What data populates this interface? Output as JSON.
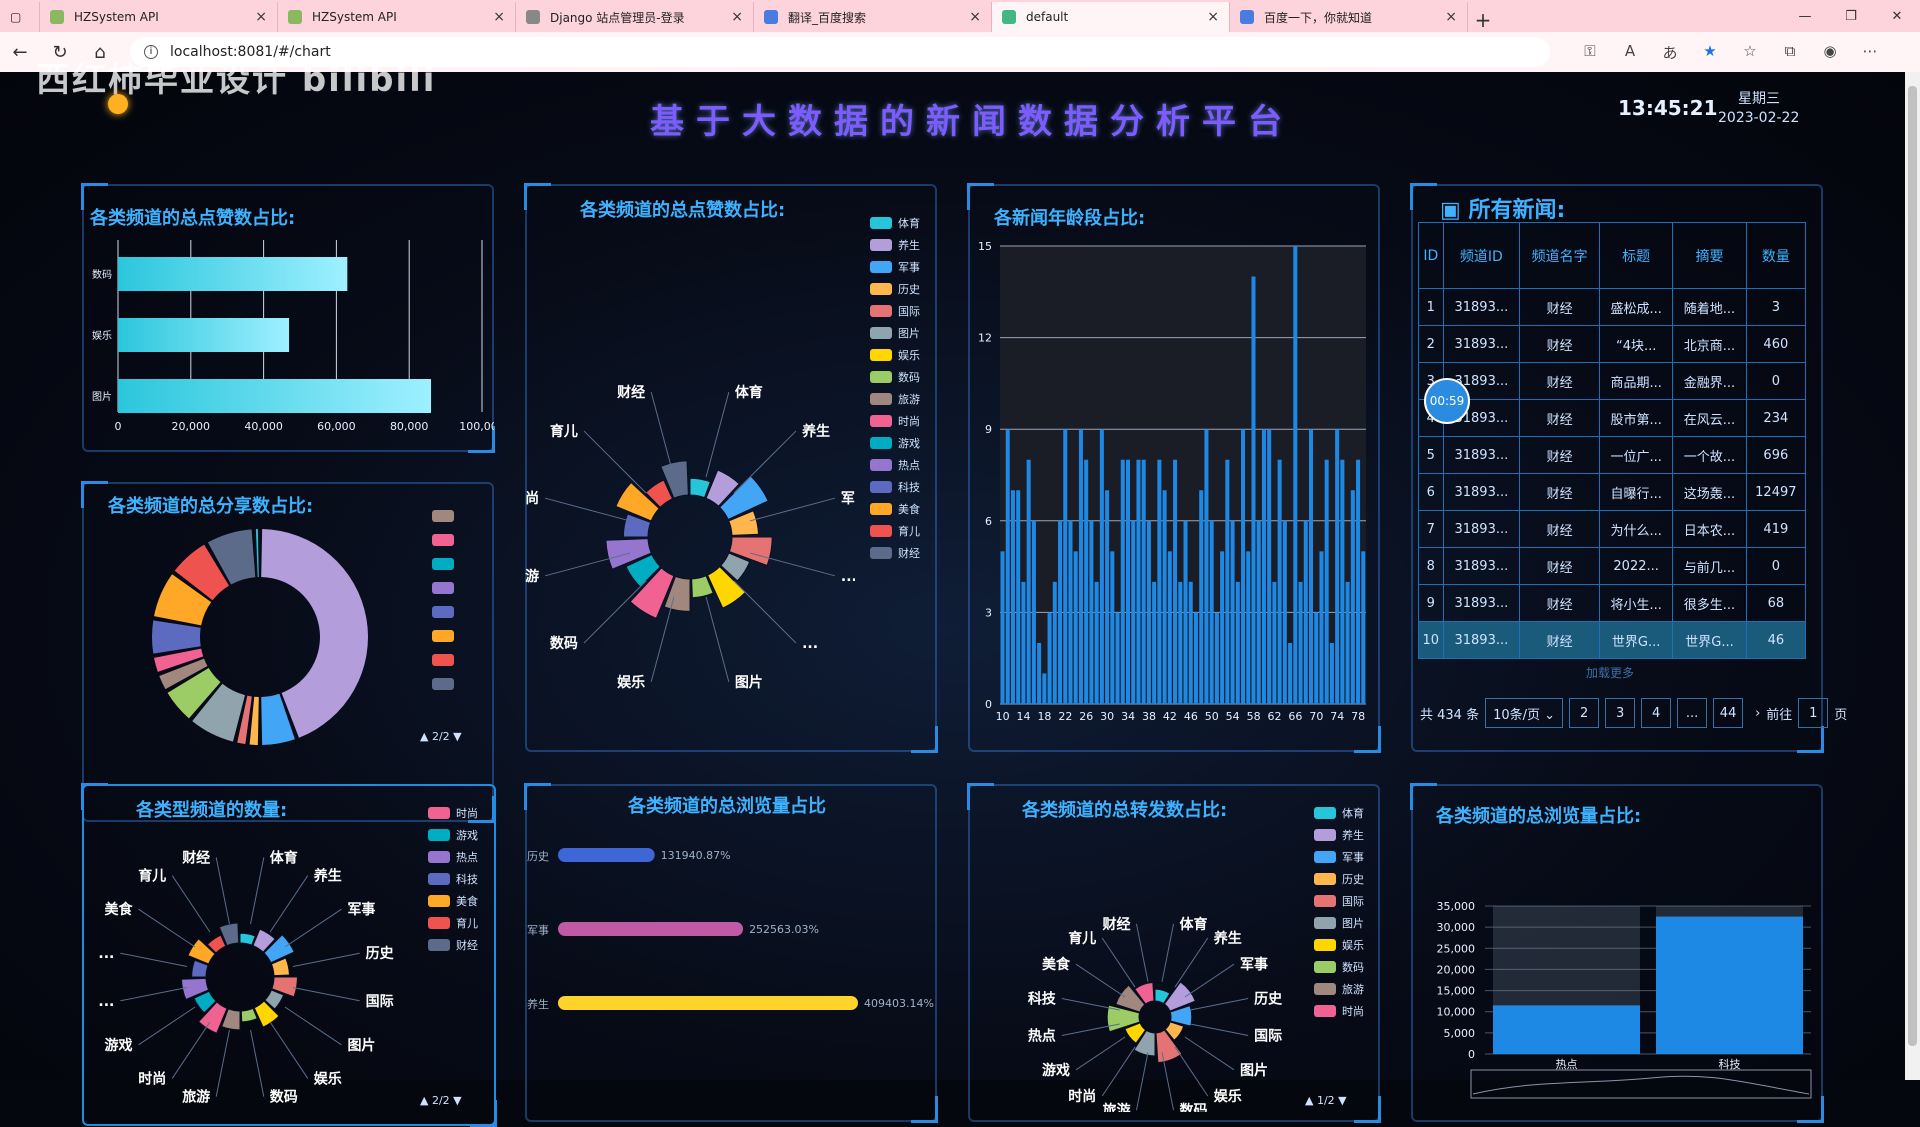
{
  "browser": {
    "tabs": [
      {
        "label": "HZSystem API",
        "icon": "globe-icon"
      },
      {
        "label": "HZSystem API",
        "icon": "globe-icon"
      },
      {
        "label": "Django 站点管理员-登录",
        "icon": "document-icon"
      },
      {
        "label": "翻译_百度搜索",
        "icon": "search-icon"
      },
      {
        "label": "default",
        "icon": "vue-icon"
      },
      {
        "label": "百度一下，你就知道",
        "icon": "baidu-icon"
      }
    ],
    "url": "localhost:8081/#/chart"
  },
  "watermark": "西红柿毕业设计 bilibili",
  "header": {
    "title": "基于大数据的新闻数据分析平台",
    "time": "13:45:21",
    "weekday": "星期三",
    "date": "2023-02-22"
  },
  "colors": {
    "accent": "#3fb2ff",
    "bar_blue": "#1e88e5",
    "cyan": "#35d4e8"
  },
  "panels": {
    "likes_bar": {
      "title": "各类频道的总点赞数占比:"
    },
    "likes_rose": {
      "title": "各类频道的总点赞数占比:"
    },
    "age": {
      "title": "各新闻年龄段占比:"
    },
    "news": {
      "title": "所有新闻:"
    },
    "share": {
      "title": "各类频道的总分享数占比:",
      "page": "2/2"
    },
    "views_bar": {
      "title": "各类频道的总浏览量占比"
    },
    "forward": {
      "title": "各类频道的总转发数占比:",
      "page": "1/2"
    },
    "views_col": {
      "title": "各类频道的总浏览量占比:"
    },
    "count": {
      "title": "各类型频道的数量:",
      "page": "2/2"
    }
  },
  "chart_data": [
    {
      "id": "likes_bar",
      "type": "bar",
      "orientation": "horizontal",
      "categories": [
        "数码",
        "娱乐",
        "图片"
      ],
      "values": [
        63000,
        47000,
        86000
      ],
      "xlim": [
        0,
        100000
      ],
      "xticks": [
        "0",
        "20,000",
        "40,000",
        "60,000",
        "80,000",
        "100,000"
      ]
    },
    {
      "id": "likes_rose",
      "type": "pie",
      "variant": "rose",
      "labels": [
        "体育",
        "养生",
        "军事",
        "历史",
        "国际",
        "图片",
        "娱乐",
        "数码",
        "旅游",
        "时尚",
        "游戏",
        "热点",
        "科技",
        "美食",
        "育儿",
        "财经"
      ],
      "outer_labels": [
        "体育",
        "养生",
        "军事",
        "...",
        "...",
        "图片",
        "娱乐",
        "数码",
        "旅游",
        "时尚",
        "育儿",
        "财经"
      ],
      "colors": [
        "#26c6da",
        "#b39ddb",
        "#42a5f5",
        "#ffb74d",
        "#e57373",
        "#90a4ae",
        "#ffd600",
        "#9ccc65",
        "#a1887f",
        "#f06292",
        "#00acc1",
        "#9575cd",
        "#5c6bc0",
        "#ffa726",
        "#ef5350",
        "#5c6b8a"
      ]
    },
    {
      "id": "age",
      "type": "bar",
      "xticks": [
        "10",
        "14",
        "18",
        "22",
        "26",
        "30",
        "34",
        "38",
        "42",
        "46",
        "50",
        "54",
        "58",
        "62",
        "66",
        "70",
        "74",
        "78"
      ],
      "ylim": [
        0,
        15
      ],
      "yticks": [
        "0",
        "3",
        "6",
        "9",
        "12",
        "15"
      ],
      "x": [
        10,
        11,
        12,
        13,
        14,
        15,
        16,
        17,
        18,
        19,
        20,
        21,
        22,
        23,
        24,
        25,
        26,
        27,
        28,
        29,
        30,
        31,
        32,
        33,
        34,
        35,
        36,
        37,
        38,
        39,
        40,
        41,
        42,
        43,
        44,
        45,
        46,
        47,
        48,
        49,
        50,
        51,
        52,
        53,
        54,
        55,
        56,
        57,
        58,
        59,
        60,
        61,
        62,
        63,
        64,
        65,
        66,
        67,
        68,
        69,
        70,
        71,
        72,
        73,
        74,
        75,
        76,
        77,
        78,
        79
      ],
      "values": [
        5,
        9,
        7,
        7,
        4,
        8,
        6,
        2,
        1,
        3,
        4,
        6,
        9,
        6,
        5,
        9,
        8,
        6,
        4,
        9,
        7,
        5,
        3,
        8,
        8,
        6,
        8,
        8,
        6,
        4,
        8,
        7,
        5,
        8,
        4,
        6,
        4,
        3,
        7,
        9,
        6,
        3,
        5,
        8,
        6,
        4,
        9,
        5,
        14,
        6,
        9,
        9,
        4,
        8,
        6,
        2,
        15,
        4,
        6,
        9,
        3,
        5,
        8,
        2,
        9,
        8,
        4,
        7,
        8,
        5
      ]
    },
    {
      "id": "share",
      "type": "pie",
      "variant": "donut",
      "legend_page": "2/2",
      "colors": [
        "#b39ddb",
        "#42a5f5",
        "#ffb74d",
        "#e57373",
        "#90a4ae",
        "#9ccc65",
        "#a1887f",
        "#f06292",
        "#5c6bc0",
        "#ffa726",
        "#ef5350",
        "#5c6b8a",
        "#26c6da"
      ],
      "values": [
        48,
        6,
        2,
        2,
        8,
        6,
        3,
        3,
        6,
        8,
        7,
        8,
        1
      ]
    },
    {
      "id": "views_bar",
      "type": "bar",
      "orientation": "horizontal",
      "categories": [
        "历史",
        "军事",
        "养生"
      ],
      "values": [
        131940,
        252563,
        409403
      ],
      "data_labels": [
        "131940.87%",
        "252563.03%",
        "409403.14%"
      ],
      "colors": [
        "#3f66d6",
        "#c05aa5",
        "#ffd42a"
      ]
    },
    {
      "id": "forward",
      "type": "pie",
      "variant": "rose",
      "legend_page": "1/2",
      "outer_labels": [
        "体育",
        "养生",
        "军事",
        "历史",
        "国际",
        "图片",
        "娱乐",
        "数码",
        "旅游",
        "时尚",
        "游戏",
        "热点",
        "科技",
        "美食",
        "育儿",
        "财经"
      ],
      "colors": [
        "#26c6da",
        "#b39ddb",
        "#42a5f5",
        "#ffb74d",
        "#e57373",
        "#90a4ae",
        "#ffd600",
        "#9ccc65",
        "#a1887f",
        "#f06292"
      ]
    },
    {
      "id": "views_col",
      "type": "bar",
      "categories": [
        "热点",
        "科技"
      ],
      "values": [
        11500,
        32500
      ],
      "ylim": [
        0,
        35000
      ],
      "yticks": [
        "0",
        "5,000",
        "10,000",
        "15,000",
        "20,000",
        "25,000",
        "30,000",
        "35,000"
      ]
    },
    {
      "id": "count",
      "type": "pie",
      "variant": "rose",
      "legend_page": "2/2",
      "outer_labels": [
        "体育",
        "养生",
        "军事",
        "历史",
        "国际",
        "图片",
        "娱乐",
        "数码",
        "旅游",
        "时尚",
        "游戏",
        "...",
        "...",
        "美食",
        "育儿",
        "财经"
      ],
      "colors": [
        "#26c6da",
        "#b39ddb",
        "#42a5f5",
        "#ffb74d",
        "#e57373",
        "#90a4ae",
        "#ffd600",
        "#9ccc65",
        "#a1887f",
        "#f06292",
        "#00acc1",
        "#9575cd",
        "#5c6bc0",
        "#ffa726",
        "#ef5350",
        "#5c6b8a"
      ]
    }
  ],
  "legends": {
    "likes_rose": [
      "体育",
      "养生",
      "军事",
      "历史",
      "国际",
      "图片",
      "娱乐",
      "数码",
      "旅游",
      "时尚",
      "游戏",
      "热点",
      "科技",
      "美食",
      "育儿",
      "财经"
    ],
    "forward": [
      "体育",
      "养生",
      "军事",
      "历史",
      "国际",
      "图片",
      "娱乐",
      "数码",
      "旅游",
      "时尚"
    ],
    "count": [
      "时尚",
      "游戏",
      "热点",
      "科技",
      "美食",
      "育儿",
      "财经"
    ]
  },
  "news_table": {
    "headers": [
      "ID",
      "频道ID",
      "频道名字",
      "标题",
      "摘要",
      "数量"
    ],
    "rows": [
      [
        "1",
        "31893...",
        "财经",
        "盛松成...",
        "随着地...",
        "3"
      ],
      [
        "2",
        "31893...",
        "财经",
        "“4块...",
        "北京商...",
        "460"
      ],
      [
        "3",
        "31893...",
        "财经",
        "商品期...",
        "金融界...",
        "0"
      ],
      [
        "4",
        "31893...",
        "财经",
        "股市第...",
        "在风云...",
        "234"
      ],
      [
        "5",
        "31893...",
        "财经",
        "一位广...",
        "一个故...",
        "696"
      ],
      [
        "6",
        "31893...",
        "财经",
        "自曝行...",
        "这场轰...",
        "12497"
      ],
      [
        "7",
        "31893...",
        "财经",
        "为什么...",
        "日本农...",
        "419"
      ],
      [
        "8",
        "31893...",
        "财经",
        "2022...",
        "与前几...",
        "0"
      ],
      [
        "9",
        "31893...",
        "财经",
        "将小生...",
        "很多生...",
        "68"
      ],
      [
        "10",
        "31893...",
        "财经",
        "世界G...",
        "世界G...",
        "46"
      ]
    ],
    "load_more": "加载更多",
    "timer": "00:59"
  },
  "pager": {
    "total": "共 434 条",
    "page_size": "10条/页",
    "pages": [
      "2",
      "3",
      "4",
      "...",
      "44"
    ],
    "goto": "前往",
    "goto_value": "1",
    "unit": "页"
  }
}
